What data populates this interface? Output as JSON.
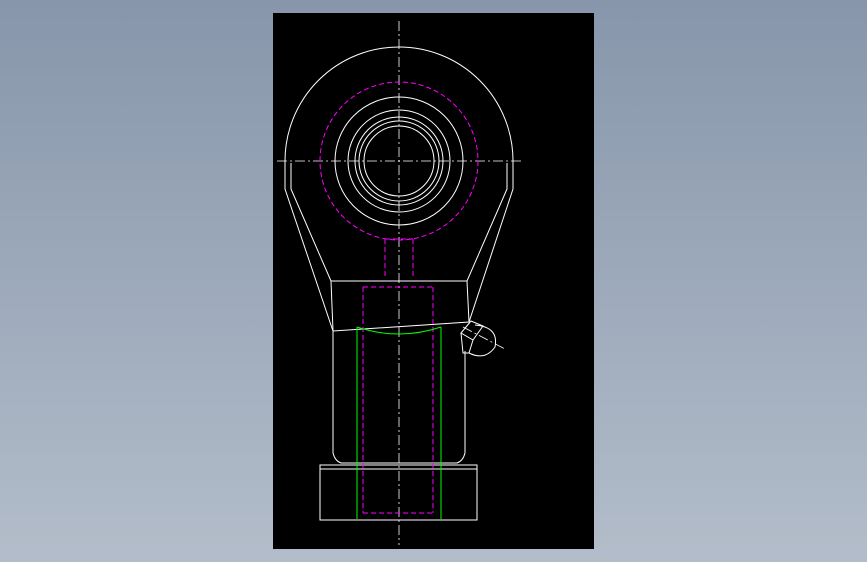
{
  "drawing": {
    "subject": "rod-end-bearing",
    "colors": {
      "background": "#000000",
      "outline": "#ffffff",
      "hidden": "#ff00ff",
      "thread": "#00ff00",
      "centerline": "#ffffff",
      "viewport_surround_top": "#8796ab",
      "viewport_surround_bottom": "#b3bdca"
    },
    "line_styles": {
      "outline": "solid",
      "hidden": "dashed",
      "centerline": "dash-dot"
    }
  }
}
